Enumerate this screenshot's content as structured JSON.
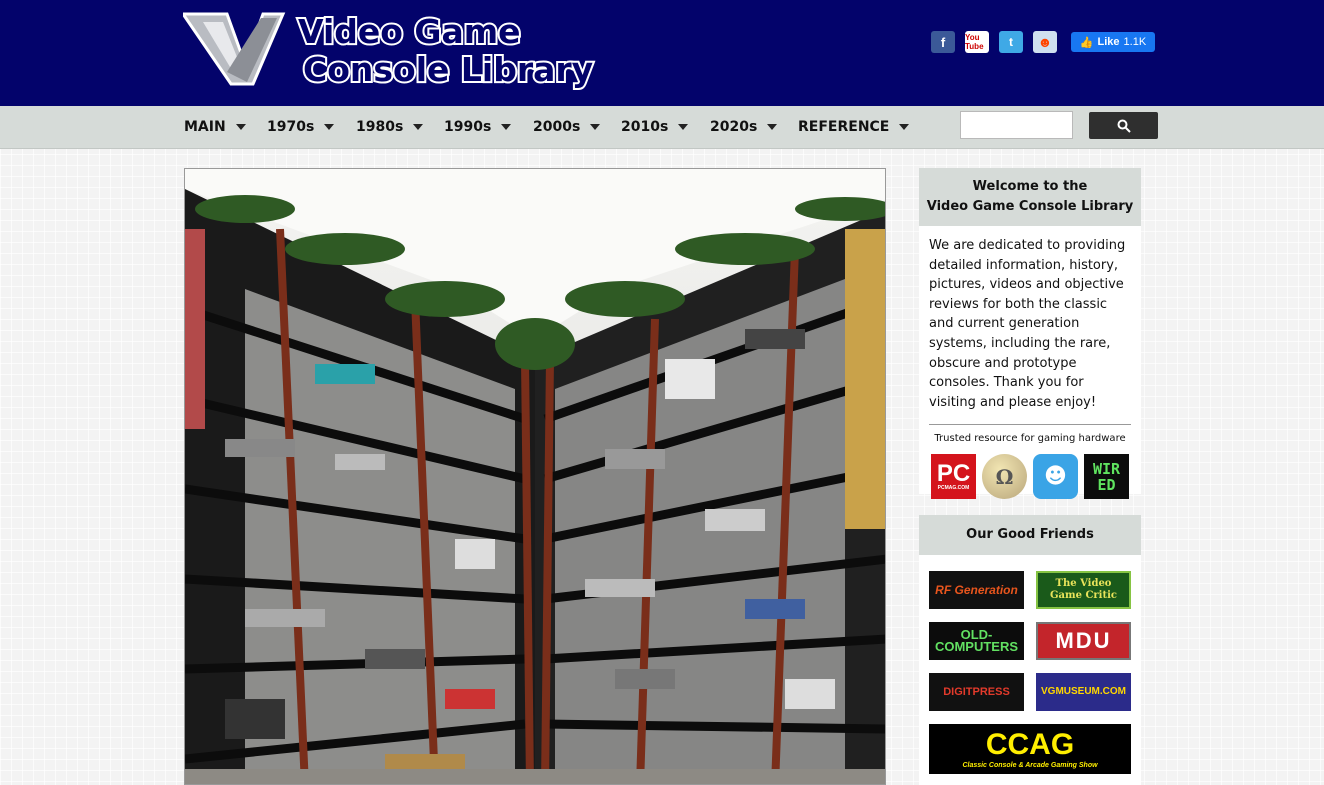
{
  "header": {
    "logo_line1": "Video Game",
    "logo_line2": "Console Library",
    "social": [
      {
        "icon": "facebook-icon",
        "glyph": "f"
      },
      {
        "icon": "youtube-icon",
        "glyph": "You Tube"
      },
      {
        "icon": "twitter-icon",
        "glyph": "t"
      },
      {
        "icon": "reddit-icon",
        "glyph": "☻"
      }
    ],
    "like_label": "Like",
    "like_count": "1.1K"
  },
  "nav": {
    "items": [
      {
        "label": "MAIN"
      },
      {
        "label": "1970s"
      },
      {
        "label": "1980s"
      },
      {
        "label": "1990s"
      },
      {
        "label": "2000s"
      },
      {
        "label": "2010s"
      },
      {
        "label": "2020s"
      },
      {
        "label": "REFERENCE"
      }
    ],
    "search_placeholder": ""
  },
  "sidebar": {
    "welcome_title_line1": "Welcome to the",
    "welcome_title_line2": "Video Game Console Library",
    "welcome_text": "We are dedicated to providing detailed information, history, pictures, videos and objective reviews for both the classic and current generation systems, including the rare, obscure and prototype consoles.  Thank you for visiting and please enjoy!",
    "trusted_text": "Trusted resource for gaming hardware",
    "trusted_logos": [
      {
        "text": "PC",
        "sub": "PCMAG.COM"
      },
      {
        "text": "Ω"
      },
      {
        "text": "☻"
      },
      {
        "text": "WIRED"
      }
    ],
    "friends_title": "Our Good Friends",
    "friends": [
      {
        "text": "RF Generation"
      },
      {
        "text": "The Video Game Critic"
      },
      {
        "text": "OLD-COMPUTERS"
      },
      {
        "text": "MDU"
      },
      {
        "text": "DIGITPRESS"
      },
      {
        "text": "VGMUSEUM.COM"
      },
      {
        "text": "CCAG",
        "sub": "Classic Console & Arcade Gaming Show"
      }
    ]
  },
  "colors": {
    "header_bg": "#03036b",
    "nav_bg": "#d6dbd8",
    "panel_head_bg": "#d6dbd8"
  }
}
